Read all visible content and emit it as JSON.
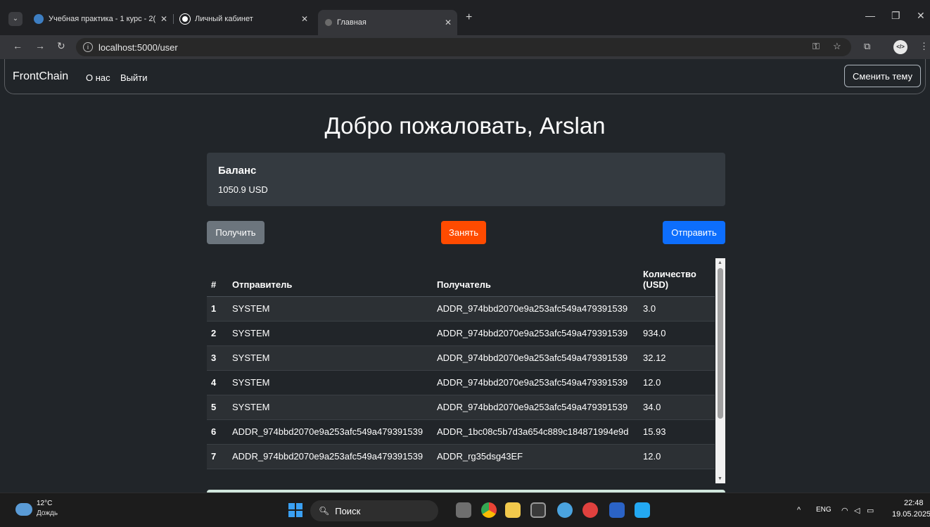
{
  "browser": {
    "tabs": [
      {
        "title": "Учебная практика - 1 курс - 2("
      },
      {
        "title": "Личный кабинет"
      },
      {
        "title": "Главная"
      }
    ],
    "url": "localhost:5000/user"
  },
  "navbar": {
    "brand": "FrontChain",
    "links": [
      "О нас",
      "Выйти"
    ],
    "theme_button": "Сменить тему"
  },
  "welcome_title": "Добро пожаловать, Arslan",
  "balance": {
    "title": "Баланс",
    "value": "1050.9 USD"
  },
  "actions": {
    "receive": "Получить",
    "borrow": "Занять",
    "send": "Отправить"
  },
  "transactions": {
    "headers": [
      "#",
      "Отправитель",
      "Получатель",
      "Количество (USD)"
    ],
    "rows": [
      [
        "1",
        "SYSTEM",
        "ADDR_974bbd2070e9a253afc549a479391539",
        "3.0"
      ],
      [
        "2",
        "SYSTEM",
        "ADDR_974bbd2070e9a253afc549a479391539",
        "934.0"
      ],
      [
        "3",
        "SYSTEM",
        "ADDR_974bbd2070e9a253afc549a479391539",
        "32.12"
      ],
      [
        "4",
        "SYSTEM",
        "ADDR_974bbd2070e9a253afc549a479391539",
        "12.0"
      ],
      [
        "5",
        "SYSTEM",
        "ADDR_974bbd2070e9a253afc549a479391539",
        "34.0"
      ],
      [
        "6",
        "ADDR_974bbd2070e9a253afc549a479391539",
        "ADDR_1bc08c5b7d3a654c889c184871994e9d",
        "15.93"
      ],
      [
        "7",
        "ADDR_974bbd2070e9a253afc549a479391539",
        "ADDR_rg35dsg43EF",
        "12.0"
      ]
    ]
  },
  "taskbar": {
    "weather_temp": "12°C",
    "weather_desc": "Дождь",
    "search_placeholder": "Поиск",
    "lang": "ENG",
    "time": "22:48",
    "date": "19.05.2025"
  },
  "colors": {
    "page_bg": "#212529",
    "receive_btn": "#6c757d",
    "borrow_btn": "#ff4b00",
    "send_btn": "#0d6efd",
    "card_bg": "#343a40",
    "alert_bg": "#d1e7dd"
  }
}
